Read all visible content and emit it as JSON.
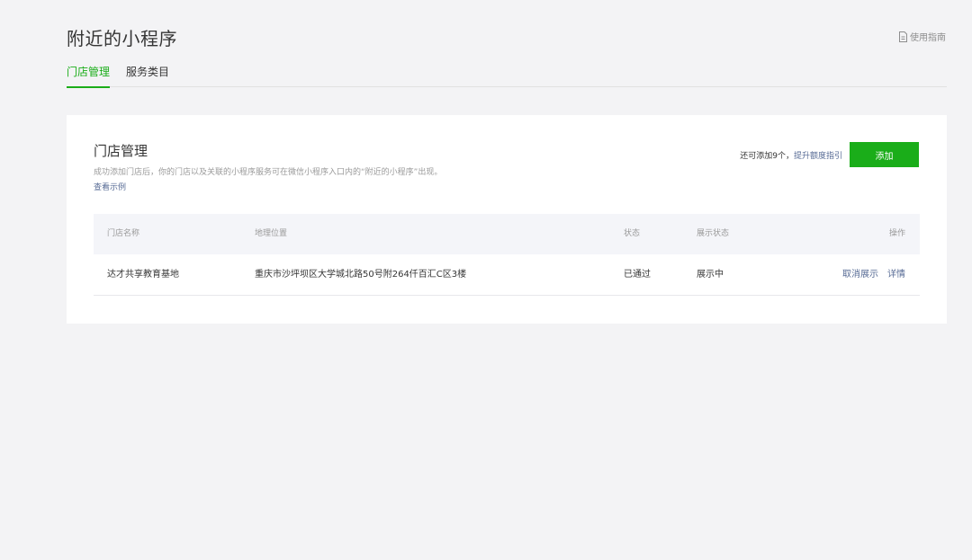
{
  "header": {
    "title": "附近的小程序",
    "guide_label": "使用指南"
  },
  "tabs": [
    {
      "label": "门店管理",
      "active": true
    },
    {
      "label": "服务类目",
      "active": false
    }
  ],
  "card": {
    "title": "门店管理",
    "description": "成功添加门店后，你的门店以及关联的小程序服务可在微信小程序入口内的“附近的小程序”出现。",
    "example_link": "查看示例",
    "quota_text": "还可添加9个，",
    "quota_link": "提升额度指引",
    "add_button": "添加"
  },
  "table": {
    "columns": [
      "门店名称",
      "地理位置",
      "状态",
      "展示状态",
      "操作"
    ],
    "rows": [
      {
        "name": "达才共享教育基地",
        "address": "重庆市沙坪坝区大学城北路50号附264仟百汇C区3楼",
        "status": "已通过",
        "display_status": "展示中",
        "actions": [
          "取消展示",
          "详情"
        ]
      }
    ]
  },
  "colors": {
    "accent": "#1aad19",
    "link": "#576b95",
    "background": "#f3f3f5"
  },
  "icons": {
    "guide": "document-icon"
  }
}
